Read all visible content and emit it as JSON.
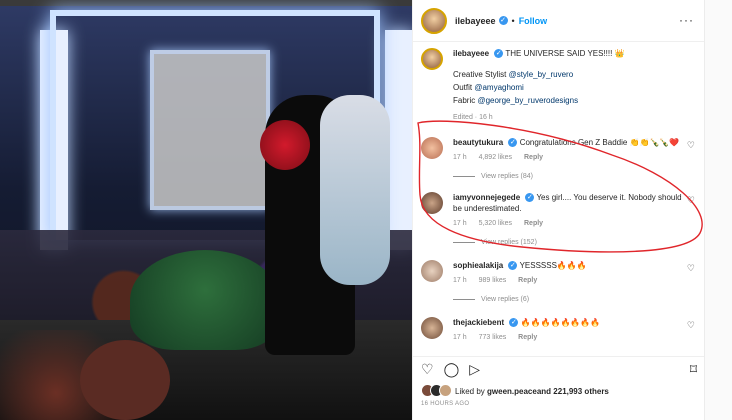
{
  "post": {
    "author": "ilebayeee",
    "follow_label": "Follow",
    "more_icon": "more-icon",
    "caption": {
      "text": "THE UNIVERSE SAID YES!!!! 👑",
      "line1_prefix": "Creative Stylist ",
      "line1_link": "@style_by_ruvero",
      "line2_prefix": "Outfit ",
      "line2_link": "@amyaghomi",
      "line3_prefix": "Fabric ",
      "line3_link": "@george_by_ruverodesigns",
      "edited": "Edited · 16 h"
    }
  },
  "comments": [
    {
      "user": "beautytukura",
      "text": "Congratulations Gen Z Baddie 👏👏🍾🍾❤️",
      "time": "17 h",
      "likes": "4,892 likes",
      "reply_label": "Reply",
      "view_replies": "View replies (84)"
    },
    {
      "user": "iamyvonnejegede",
      "text": "Yes girl.... You deserve it. Nobody should be underestimated.",
      "time": "17 h",
      "likes": "5,320 likes",
      "reply_label": "Reply",
      "view_replies": "View replies (152)"
    },
    {
      "user": "sophiealakija",
      "text": "YESSSSS🔥🔥🔥",
      "time": "17 h",
      "likes": "989 likes",
      "reply_label": "Reply",
      "view_replies": "View replies (6)"
    },
    {
      "user": "thejackiebent",
      "text": "🔥🔥🔥🔥🔥🔥🔥🔥",
      "time": "17 h",
      "likes": "773 likes",
      "reply_label": "Reply"
    }
  ],
  "footer": {
    "liked_prefix": "Liked by ",
    "liked_user": "gween.peace",
    "liked_suffix": " and 221,993 others",
    "date": "16 HOURS AGO"
  },
  "icons": {
    "heart": "♡",
    "comment": "◯",
    "share": "▷",
    "bookmark": "⌑",
    "more": "···"
  },
  "colors": {
    "follow_blue": "#0095f6",
    "link_blue": "#00376b",
    "highlight_red": "#e0262b"
  }
}
